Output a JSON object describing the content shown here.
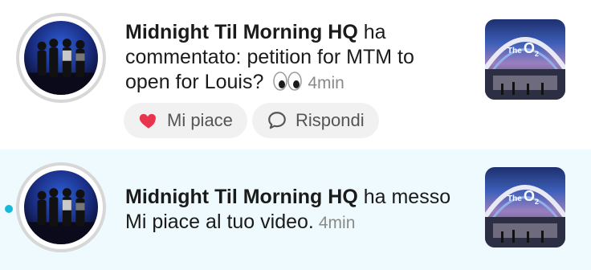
{
  "notifications": [
    {
      "name": "Midnight Til Morning HQ",
      "action": " ha commentato: petition for MTM to open for Louis?",
      "emoji_icon": "eyes-emoji-icon",
      "time": "4min",
      "unread": false
    },
    {
      "name": "Midnight Til Morning HQ",
      "action": " ha messo Mi piace al tuo video.",
      "time": "4min",
      "unread": true
    }
  ],
  "actions": {
    "like_label": "Mi piace",
    "reply_label": "Rispondi"
  },
  "thumbnail": {
    "logo_text_the": "The",
    "logo_text_o": "O",
    "logo_text_2": "2"
  },
  "colors": {
    "unread_bg": "#eefafd",
    "unread_dot": "#18b9d8",
    "heart": "#e8344e"
  }
}
